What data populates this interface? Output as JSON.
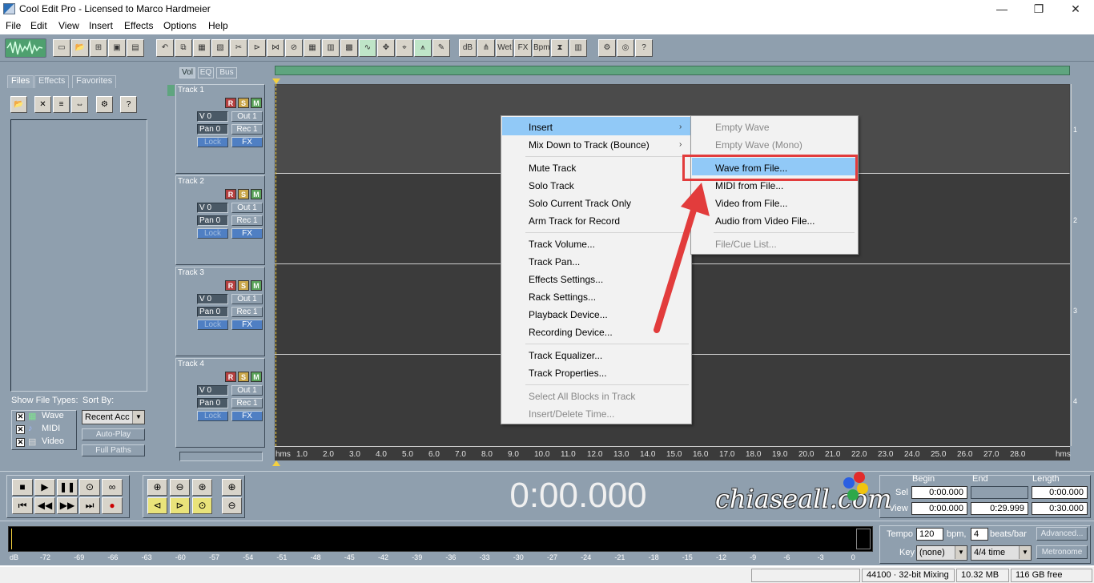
{
  "window": {
    "title": "Cool Edit Pro - Licensed to Marco Hardmeier",
    "minimize": "—",
    "maximize": "❐",
    "close": "✕"
  },
  "menubar": [
    "File",
    "Edit",
    "View",
    "Insert",
    "Effects",
    "Options",
    "Help"
  ],
  "organizer": {
    "tabs": [
      "Files",
      "Effects",
      "Favorites"
    ],
    "show_file_types_label": "Show File Types:",
    "sort_by_label": "Sort By:",
    "file_types": [
      {
        "label": "Wave",
        "checked": true
      },
      {
        "label": "MIDI",
        "checked": true
      },
      {
        "label": "Video",
        "checked": true
      }
    ],
    "sort_value": "Recent Acc",
    "auto_play": "Auto-Play",
    "full_paths": "Full Paths"
  },
  "track_tabs": [
    "Vol",
    "EQ",
    "Bus"
  ],
  "tracks": [
    {
      "name": "Track 1",
      "vol": "V 0",
      "pan": "Pan 0",
      "out": "Out 1",
      "rec": "Rec 1",
      "lock": "Lock",
      "fx": "FX",
      "r": "R",
      "s": "S",
      "m": "M",
      "lane": "1"
    },
    {
      "name": "Track 2",
      "vol": "V 0",
      "pan": "Pan 0",
      "out": "Out 1",
      "rec": "Rec 1",
      "lock": "Lock",
      "fx": "FX",
      "r": "R",
      "s": "S",
      "m": "M",
      "lane": "2"
    },
    {
      "name": "Track 3",
      "vol": "V 0",
      "pan": "Pan 0",
      "out": "Out 1",
      "rec": "Rec 1",
      "lock": "Lock",
      "fx": "FX",
      "r": "R",
      "s": "S",
      "m": "M",
      "lane": "3"
    },
    {
      "name": "Track 4",
      "vol": "V 0",
      "pan": "Pan 0",
      "out": "Out 1",
      "rec": "Rec 1",
      "lock": "Lock",
      "fx": "FX",
      "r": "R",
      "s": "S",
      "m": "M",
      "lane": "4"
    }
  ],
  "ruler": {
    "start": "hms",
    "end": "hms",
    "ticks": [
      "1.0",
      "2.0",
      "3.0",
      "4.0",
      "5.0",
      "6.0",
      "7.0",
      "8.0",
      "9.0",
      "10.0",
      "11.0",
      "12.0",
      "13.0",
      "14.0",
      "15.0",
      "16.0",
      "17.0",
      "18.0",
      "19.0",
      "20.0",
      "21.0",
      "22.0",
      "23.0",
      "24.0",
      "25.0",
      "26.0",
      "27.0",
      "28.0"
    ]
  },
  "context_menu": {
    "items": [
      {
        "label": "Insert",
        "submenu": true,
        "highlighted": true
      },
      {
        "label": "Mix Down to Track (Bounce)",
        "submenu": true
      },
      {
        "sep": true
      },
      {
        "label": "Mute Track"
      },
      {
        "label": "Solo Track"
      },
      {
        "label": "Solo Current Track Only"
      },
      {
        "label": "Arm Track for Record"
      },
      {
        "sep": true
      },
      {
        "label": "Track Volume..."
      },
      {
        "label": "Track Pan..."
      },
      {
        "label": "Effects Settings..."
      },
      {
        "label": "Rack Settings..."
      },
      {
        "label": "Playback Device..."
      },
      {
        "label": "Recording Device..."
      },
      {
        "sep": true
      },
      {
        "label": "Track Equalizer..."
      },
      {
        "label": "Track Properties..."
      },
      {
        "sep": true
      },
      {
        "label": "Select All Blocks in Track",
        "disabled": true
      },
      {
        "label": "Insert/Delete Time...",
        "disabled": true
      }
    ],
    "submenu": [
      {
        "label": "Empty Wave",
        "disabled": true
      },
      {
        "label": "Empty Wave (Mono)",
        "disabled": true
      },
      {
        "label": "Wave from File...",
        "highlighted": true
      },
      {
        "label": "MIDI from File..."
      },
      {
        "label": "Video from File..."
      },
      {
        "label": "Audio from Video File..."
      },
      {
        "sep": true
      },
      {
        "label": "File/Cue List...",
        "disabled": true
      }
    ]
  },
  "transport": {
    "time": "0:00.000",
    "headers": {
      "begin": "Begin",
      "end": "End",
      "length": "Length"
    },
    "sel_label": "Sel",
    "view_label": "View",
    "sel": {
      "begin": "0:00.000",
      "end": "",
      "length": "0:00.000"
    },
    "view": {
      "begin": "0:00.000",
      "end": "0:29.999",
      "length": "0:30.000"
    }
  },
  "watermark": "chiaseall.com",
  "tempo": {
    "tempo_label": "Tempo",
    "tempo": "120",
    "bpm": "bpm,",
    "beats": "4",
    "beats_label": "beats/bar",
    "advanced": "Advanced...",
    "key_label": "Key",
    "key": "(none)",
    "time_sig": "4/4 time",
    "metronome": "Metronome"
  },
  "meter": {
    "labels": [
      "dB",
      "-72",
      "-69",
      "-66",
      "-63",
      "-60",
      "-57",
      "-54",
      "-51",
      "-48",
      "-45",
      "-42",
      "-39",
      "-36",
      "-33",
      "-30",
      "-27",
      "-24",
      "-21",
      "-18",
      "-15",
      "-12",
      "-9",
      "-6",
      "-3",
      "0"
    ]
  },
  "status": {
    "mixing": "44100 · 32-bit Mixing",
    "memory": "10.32 MB",
    "free": "116 GB free"
  },
  "colors": {
    "panel": "#8f9fae",
    "track_bg": "#3b3b3b",
    "highlight": "#91c9f7",
    "callout": "#e23c3c"
  }
}
